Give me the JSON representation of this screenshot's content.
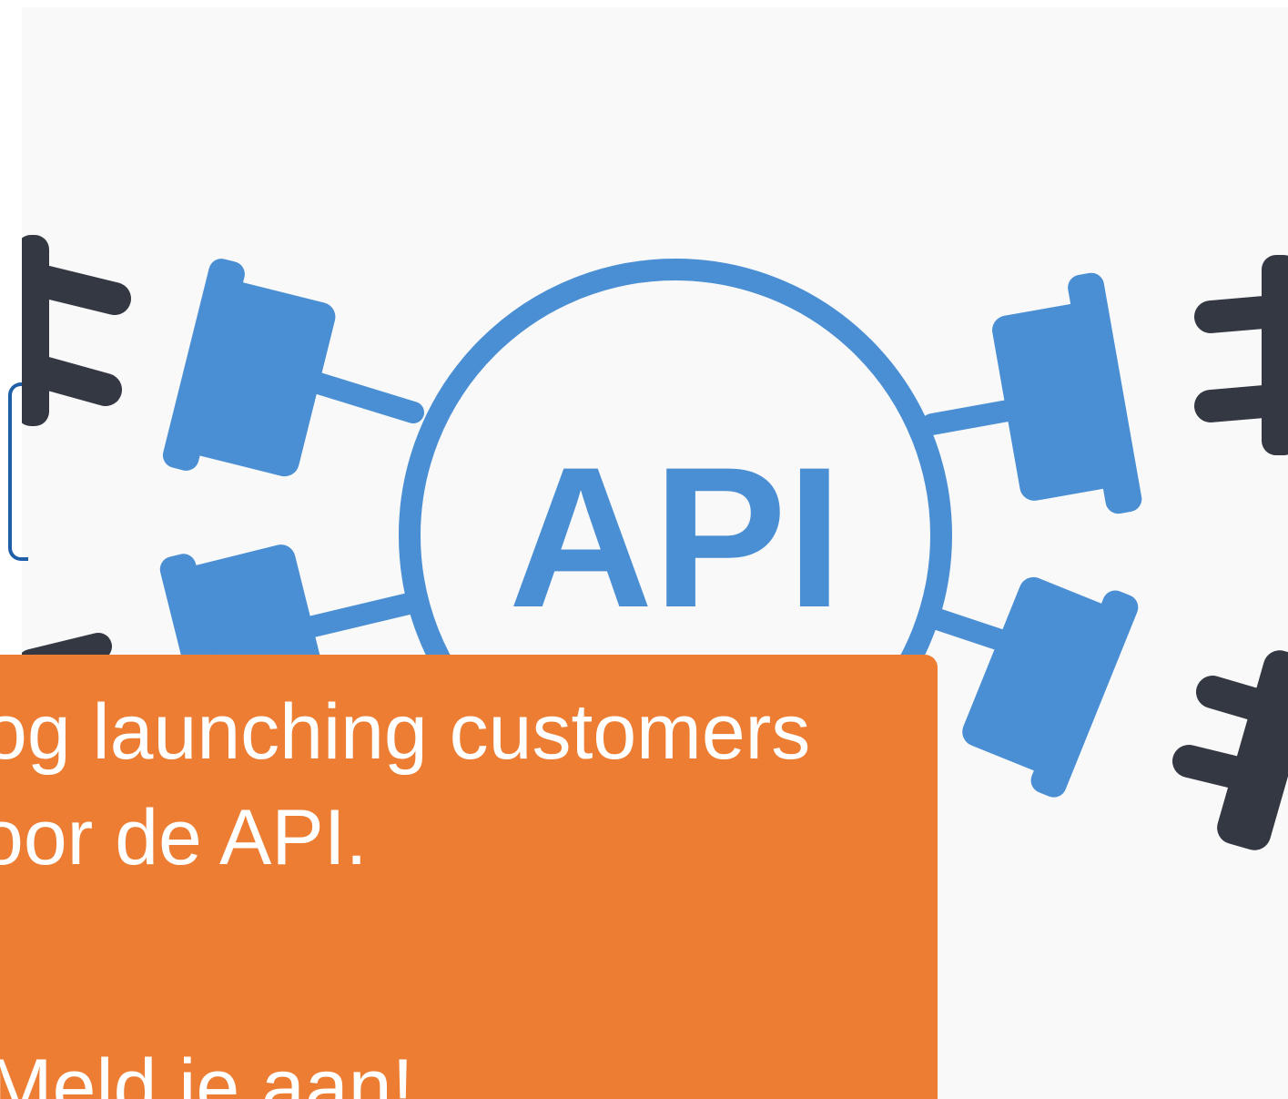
{
  "illustration": {
    "center_label": "API",
    "icon": "api-plug-network-icon",
    "colors": {
      "accent_blue": "#4a8fd4",
      "plug_dark": "#333842",
      "background": "#f9f9f9"
    }
  },
  "promo": {
    "line1": "og launching customers",
    "line2": "oor de API.",
    "line3": "Meld je aan!",
    "background_color": "#ec7d32",
    "text_color": "#ffffff"
  }
}
